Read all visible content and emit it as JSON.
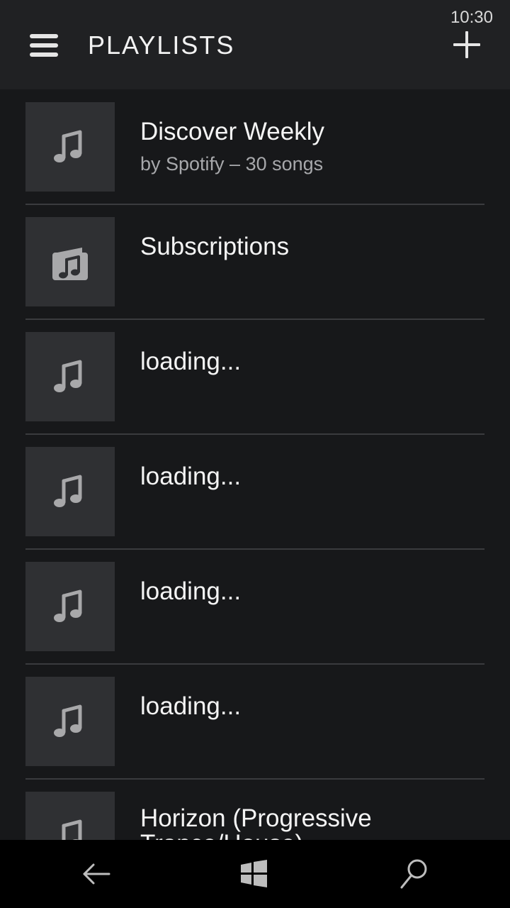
{
  "status_bar": {
    "time": "10:30"
  },
  "header": {
    "title": "PLAYLISTS",
    "menu_icon": "hamburger-menu-icon",
    "add_icon": "plus-icon"
  },
  "playlists": [
    {
      "title": "Discover Weekly",
      "subtitle": "by Spotify – 30 songs",
      "icon": "music-note-icon"
    },
    {
      "title": "Subscriptions",
      "subtitle": "",
      "icon": "album-music-icon"
    },
    {
      "title": "loading...",
      "subtitle": "",
      "icon": "music-note-icon"
    },
    {
      "title": "loading...",
      "subtitle": "",
      "icon": "music-note-icon"
    },
    {
      "title": "loading...",
      "subtitle": "",
      "icon": "music-note-icon"
    },
    {
      "title": "loading...",
      "subtitle": "",
      "icon": "music-note-icon"
    },
    {
      "title": "Horizon (Progressive Trance/House)",
      "subtitle": "",
      "icon": "music-note-icon"
    }
  ],
  "navigation": {
    "back_icon": "back-arrow-icon",
    "windows_icon": "windows-logo-icon",
    "search_icon": "search-icon"
  },
  "colors": {
    "background": "#17181a",
    "header_background": "#202123",
    "thumbnail_background": "#2f3033",
    "divider": "#3a3b3e",
    "primary_text": "#f4f4f4",
    "secondary_text": "#a7a8ab",
    "navigation_background": "#000000"
  }
}
